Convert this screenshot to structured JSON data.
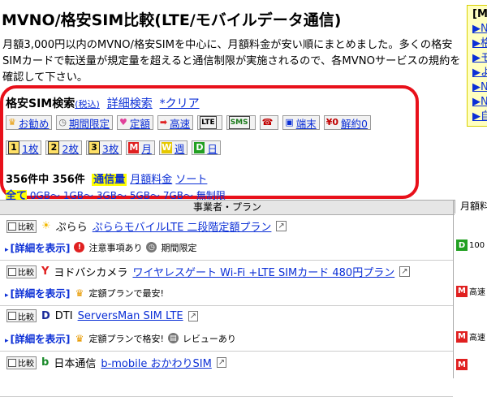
{
  "page": {
    "title": "MVNO/格安SIM比較(LTE/モバイルデータ通信)",
    "intro": "月額3,000円以内のMVNO/格安SIMを中心に、月額料金が安い順にまとめました。多くの格安SIMカードで転送量が規定量を超えると通信制限が実施されるので、各MVNOサービスの規約を確認して下さい。"
  },
  "sidebar": {
    "heading": "[M",
    "items": [
      "▶N",
      "▶格",
      "▶モ",
      "▶よ",
      "▶N",
      "▶N",
      "▶自"
    ]
  },
  "search": {
    "title": "格安SIM検索",
    "tax_label": "(税込)",
    "detail_link": "詳細検索",
    "clear_link": "*クリア",
    "row1": [
      {
        "icon": "crown-icon",
        "glyph": "♛",
        "color": "#e89a00",
        "label": "お勧め"
      },
      {
        "icon": "clock-icon",
        "glyph": "◷",
        "color": "#666666",
        "label": "期間限定"
      },
      {
        "icon": "hearts-icon",
        "glyph": "♥",
        "color": "#e0409a",
        "label": "定額"
      },
      {
        "icon": "arrow-right-icon",
        "glyph": "➡",
        "color": "#e02020",
        "label": "高速"
      },
      {
        "icon": "lte-icon",
        "glyph": "LTE",
        "color": "#000000",
        "label": ""
      },
      {
        "icon": "sms-icon",
        "glyph": "SMS",
        "color": "#1a7a1a",
        "label": ""
      },
      {
        "icon": "phone-icon",
        "glyph": "☎",
        "color": "#c00000",
        "label": ""
      },
      {
        "icon": "device-icon",
        "glyph": "▣",
        "color": "#0b2fd6",
        "label": "端末"
      },
      {
        "icon": "yen-zero-icon",
        "glyph": "¥0",
        "color": "#c00000",
        "label": "解約0"
      }
    ],
    "row2": [
      {
        "icon": "sim-1-icon",
        "glyph": "1",
        "label": "1枚"
      },
      {
        "icon": "sim-2-icon",
        "glyph": "2",
        "label": "2枚"
      },
      {
        "icon": "sim-3-icon",
        "glyph": "3",
        "label": "3枚"
      },
      {
        "icon": "monthly-icon",
        "glyph": "M",
        "color": "#e02020",
        "label": "月"
      },
      {
        "icon": "weekly-icon",
        "glyph": "W",
        "color": "#e6c800",
        "label": "週"
      },
      {
        "icon": "daily-icon",
        "glyph": "D",
        "color": "#22a022",
        "label": "日"
      }
    ],
    "count_text": "356件中 356件",
    "sort_active": "通信量",
    "sort_price": "月額料金",
    "sort_label": "ソート",
    "gb_all": "全て",
    "gb_links": [
      "0GB～",
      "1GB～",
      "3GB～",
      "5GB～",
      "7GB～",
      "無制限"
    ]
  },
  "table": {
    "col_plan": "事業者・プラン",
    "col_price": "月額料",
    "rows": [
      {
        "compare": "比較",
        "logo": "☀",
        "logo_color": "#f2b800",
        "company": "ぷらら",
        "plan": "ぷららモバイルLTE 二段階定額プラン",
        "detail": "[詳細を表示]",
        "notes": [
          {
            "icon": "warning-icon",
            "glyph": "!",
            "color": "#e02020",
            "text": "注意事項あり"
          },
          {
            "icon": "clock-icon",
            "glyph": "◷",
            "color": "#777777",
            "text": "期間限定"
          }
        ],
        "right_badge": "D",
        "right_color": "#22a022",
        "right_text": "100"
      },
      {
        "compare": "比較",
        "logo": "Y",
        "logo_color": "#e02020",
        "company": "ヨドバシカメラ",
        "plan": "ワイヤレスゲート Wi-Fi +LTE SIMカード 480円プラン",
        "detail": "[詳細を表示]",
        "notes": [
          {
            "icon": "crown-icon",
            "glyph": "♛",
            "color": "#e89a00",
            "text": "定額プランで最安!"
          }
        ],
        "right_badge": "M",
        "right_color": "#e02020",
        "right_text": "高速"
      },
      {
        "compare": "比較",
        "logo": "D",
        "logo_color": "#1a2a9a",
        "company": "DTI",
        "plan": "ServersMan SIM LTE",
        "detail": "[詳細を表示]",
        "notes": [
          {
            "icon": "crown-icon",
            "glyph": "♛",
            "color": "#e89a00",
            "text": "定額プランで格安!"
          },
          {
            "icon": "chat-icon",
            "glyph": "▤",
            "color": "#777777",
            "text": "レビューあり"
          }
        ],
        "right_badge": "M",
        "right_color": "#e02020",
        "right_text": "高速"
      },
      {
        "compare": "比較",
        "logo": "b",
        "logo_color": "#1a8a2a",
        "company": "日本通信",
        "plan": "b-mobile おかわりSIM",
        "detail": "",
        "notes": [],
        "right_badge": "M",
        "right_color": "#e02020",
        "right_text": ""
      }
    ]
  }
}
